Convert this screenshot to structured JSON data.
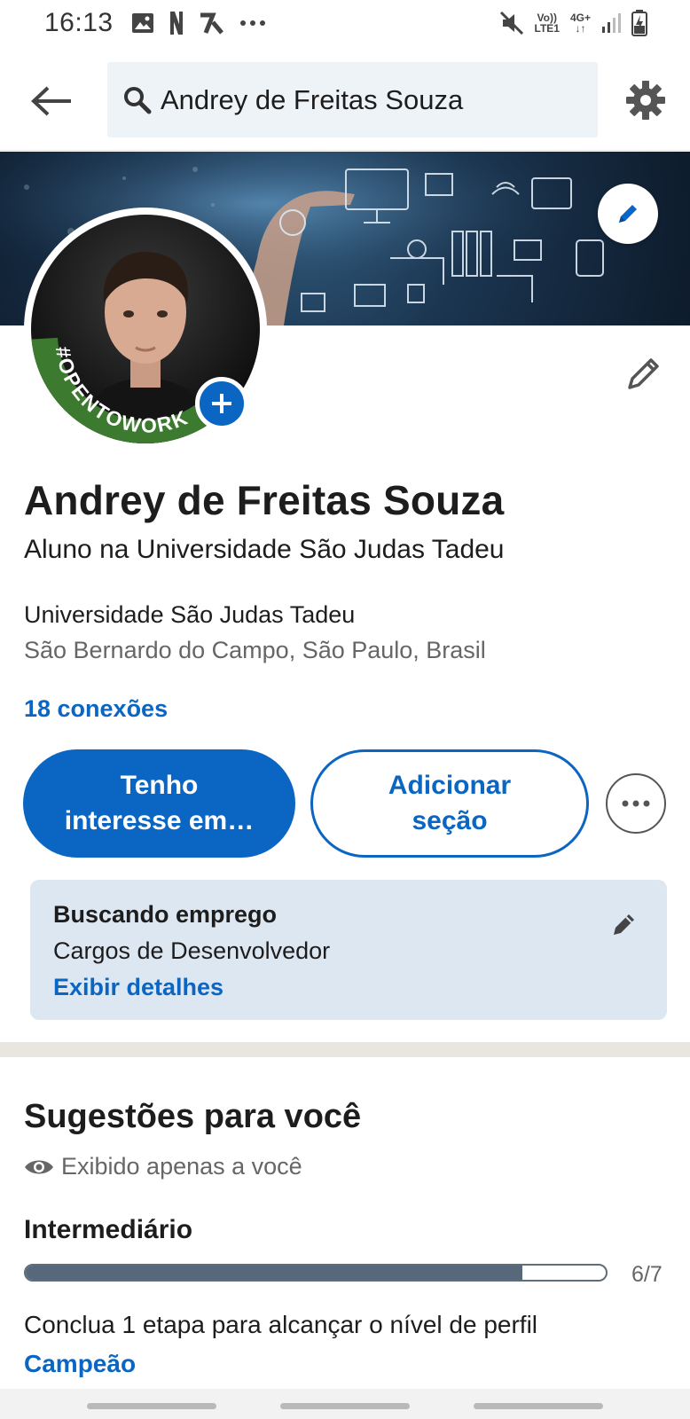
{
  "status_bar": {
    "time": "16:13",
    "network_top": "Vo))",
    "network_bottom": "LTE1",
    "data_top": "4G+"
  },
  "header": {
    "search_value": "Andrey de Freitas Souza"
  },
  "profile": {
    "name": "Andrey de Freitas Souza",
    "headline": "Aluno na Universidade São Judas Tadeu",
    "school": "Universidade São Judas Tadeu",
    "location": "São Bernardo do Campo, São Paulo, Brasil",
    "connections": "18 conexões",
    "frame_text": "#OPENTOWORK"
  },
  "actions": {
    "primary_label": "Tenho interesse em…",
    "secondary_label": "Adicionar seção"
  },
  "open_to_work": {
    "title": "Buscando emprego",
    "subtitle": "Cargos de Desenvolvedor",
    "link": "Exibir detalhes"
  },
  "suggestions": {
    "title": "Sugestões para você",
    "visibility": "Exibido apenas a você",
    "level": "Intermediário",
    "progress_text": "6/7",
    "progress_fraction": 0.857,
    "description": "Conclua 1 etapa para alcançar o nível de perfil",
    "next_level": "Campeão"
  },
  "colors": {
    "accent": "#0a66c2",
    "otw_green": "#3c7a2f",
    "card_bg": "#dde7f1"
  }
}
